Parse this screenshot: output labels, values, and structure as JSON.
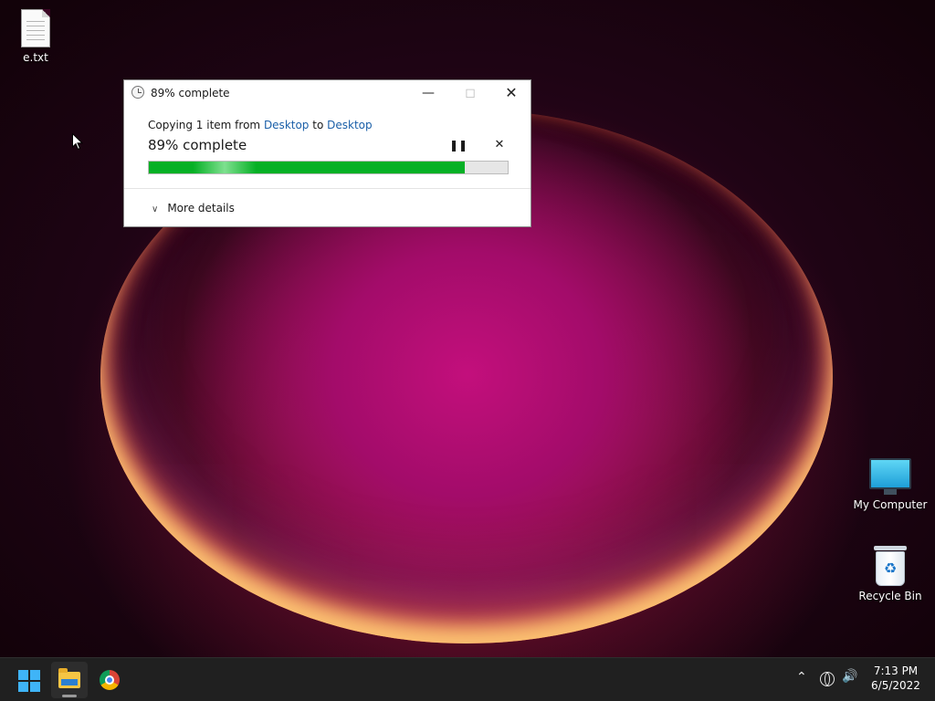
{
  "desktop": {
    "icons": [
      {
        "label": "e.txt",
        "icon": "text-file-icon"
      },
      {
        "label": "My Computer",
        "icon": "monitor-icon"
      },
      {
        "label": "Recycle Bin",
        "icon": "recycle-bin-icon"
      }
    ]
  },
  "dialog": {
    "title": "89% complete",
    "copy_prefix": "Copying 1 item from ",
    "source": "Desktop",
    "copy_mid": " to ",
    "destination": "Desktop",
    "status": "89% complete",
    "progress": 0.88,
    "more_details": "More details",
    "progress_color": "#06b025"
  },
  "taskbar": {
    "apps": [
      "start",
      "file-explorer",
      "chrome"
    ],
    "time": "7:13 PM",
    "date": "6/5/2022"
  }
}
